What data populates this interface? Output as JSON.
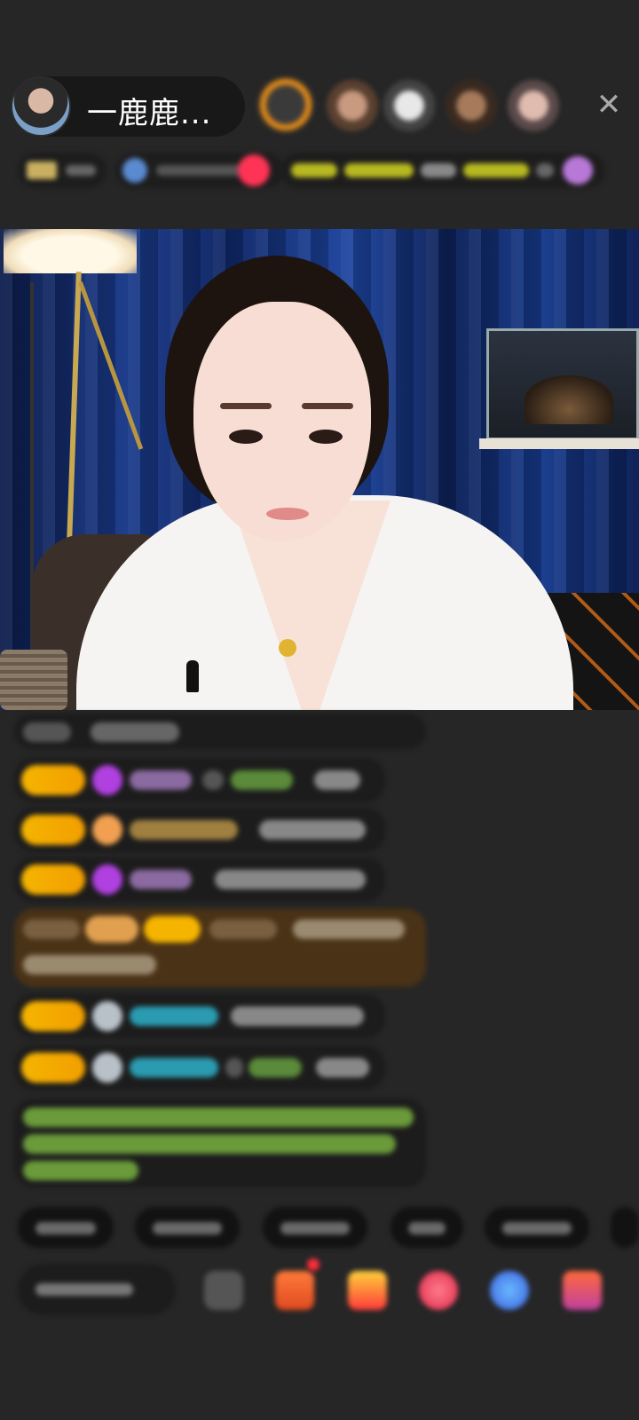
{
  "header": {
    "host_name": "一鹿鹿...",
    "close_glyph": "✕"
  },
  "colors": {
    "badge": "#f5b400",
    "highlight_bg": "#5a3a14",
    "green_text": "#8bc34a",
    "teal_name": "#2a9bb0"
  }
}
